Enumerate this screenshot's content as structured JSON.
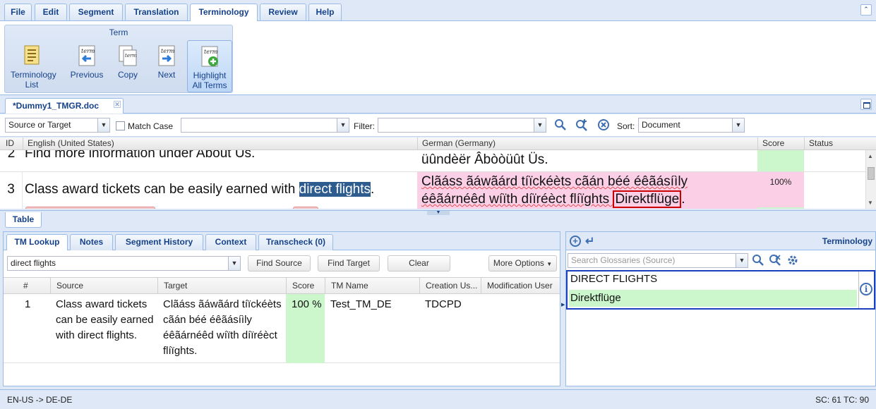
{
  "menu": {
    "tabs": [
      {
        "label": "File"
      },
      {
        "label": "Edit"
      },
      {
        "label": "Segment"
      },
      {
        "label": "Translation"
      },
      {
        "label": "Terminology"
      },
      {
        "label": "Review"
      },
      {
        "label": "Help"
      }
    ],
    "active": "Terminology"
  },
  "ribbon": {
    "group_title": "Term",
    "buttons": [
      {
        "label": "Terminology List",
        "icon": "terminology-list-icon"
      },
      {
        "label": "Previous",
        "icon": "previous-term-icon"
      },
      {
        "label": "Copy",
        "icon": "copy-term-icon"
      },
      {
        "label": "Next",
        "icon": "next-term-icon"
      },
      {
        "label": "Highlight All Terms",
        "icon": "highlight-terms-icon"
      }
    ]
  },
  "document": {
    "tab_label": "*Dummy1_TMGR.doc"
  },
  "filter": {
    "scope": "Source or Target",
    "match_case": "Match Case",
    "filter_label": "Filter:",
    "sort_label": "Sort:",
    "sort_value": "Document"
  },
  "grid": {
    "headers": {
      "id": "ID",
      "source": "English (United States)",
      "target": "German (Germany)",
      "score": "Score",
      "status": "Status"
    },
    "row2": {
      "id": "2",
      "source": "Find more information under About Us.",
      "target": "üûndèër Âbòòüût Üs."
    },
    "row3": {
      "id": "3",
      "source_before": "Class award tickets can be easily earned with ",
      "source_highlight": "direct flights",
      "source_after": ".",
      "target_line1": "Clãáss ãáwãárd tíïckéèts cãán béé éêãásíìly",
      "target_line2": "éêãárnéêd wíïth díïréèct flíïghts ",
      "target_term": "Direktflüge",
      "target_end": ".",
      "score": "100%"
    }
  },
  "table_tab": "Table",
  "lower_tabs": [
    {
      "label": "TM Lookup"
    },
    {
      "label": "Notes"
    },
    {
      "label": "Segment History"
    },
    {
      "label": "Context"
    },
    {
      "label": "Transcheck (0)"
    }
  ],
  "tm_lookup": {
    "query": "direct flights",
    "buttons": {
      "find_source": "Find Source",
      "find_target": "Find Target",
      "clear": "Clear",
      "more": "More Options"
    },
    "headers": {
      "num": "#",
      "source": "Source",
      "target": "Target",
      "score": "Score",
      "tm_name": "TM Name",
      "creation": "Creation Us...",
      "modification": "Modification User"
    },
    "row": {
      "num": "1",
      "source": "Class award tickets can be easily earned with direct flights.",
      "target": "Clãáss ãáwãárd tíïckéèts cãán béé éêãásíìly éêãárnéêd wíïth díïréèct flíïghts.",
      "score": "100 %",
      "tm_name": "Test_TM_DE",
      "creation": "TDCPD",
      "modification": ""
    }
  },
  "terminology": {
    "title": "Terminology",
    "search_placeholder": "Search Glossaries (Source)",
    "source_term": "DIRECT FLIGHTS",
    "target_term": "Direktflüge"
  },
  "status": {
    "lang_pair": "EN-US -> DE-DE",
    "counts": "SC: 61  TC: 90"
  },
  "colors": {
    "accent": "#15428b",
    "score_green": "#ccf7cc",
    "target_pink": "#fbd0e6",
    "highlight": "#2e5c8f",
    "term_border": "#cc0000"
  }
}
